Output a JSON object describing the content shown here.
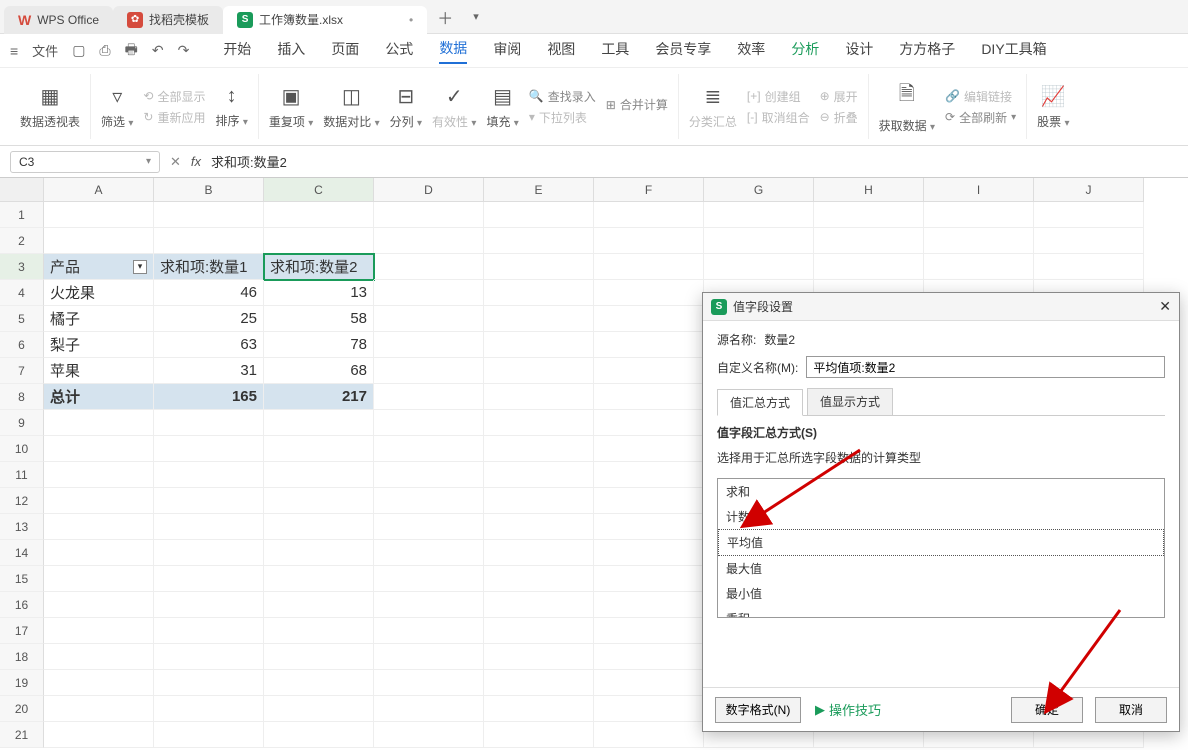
{
  "tabs": {
    "wps": "WPS Office",
    "dk": "找稻壳模板",
    "file": "工作簿数量.xlsx"
  },
  "menu": {
    "file": "文件",
    "items": [
      "开始",
      "插入",
      "页面",
      "公式",
      "数据",
      "审阅",
      "视图",
      "工具",
      "会员专享",
      "效率",
      "分析",
      "设计",
      "方方格子",
      "DIY工具箱"
    ],
    "active_index": 4
  },
  "ribbon": {
    "pivot": "数据透视表",
    "filter": "筛选",
    "showall": "全部显示",
    "reapply": "重新应用",
    "sort": "排序",
    "dup": "重复项",
    "datacompare": "数据对比",
    "split": "分列",
    "validity": "有效性",
    "fill": "填充",
    "findrec": "查找录入",
    "merge": "合并计算",
    "dropdown": "下拉列表",
    "subtotal": "分类汇总",
    "group": "创建组",
    "ungroup": "取消组合",
    "expand": "展开",
    "collapse": "折叠",
    "getdata": "获取数据",
    "editlink": "编辑链接",
    "refreshall": "全部刷新",
    "stock": "股票"
  },
  "formula": {
    "namebox": "C3",
    "value": "求和项:数量2"
  },
  "columns": [
    "A",
    "B",
    "C",
    "D",
    "E",
    "F",
    "G",
    "H",
    "I",
    "J"
  ],
  "rows": 21,
  "pivot": {
    "headers": [
      "产品",
      "求和项:数量1",
      "求和项:数量2"
    ],
    "data": [
      {
        "p": "火龙果",
        "q1": 46,
        "q2": 13
      },
      {
        "p": "橘子",
        "q1": 25,
        "q2": 58
      },
      {
        "p": "梨子",
        "q1": 63,
        "q2": 78
      },
      {
        "p": "苹果",
        "q1": 31,
        "q2": 68
      }
    ],
    "total_label": "总计",
    "total_q1": 165,
    "total_q2": 217
  },
  "dialog": {
    "title": "值字段设置",
    "source_label": "源名称:",
    "source_value": "数量2",
    "custom_label": "自定义名称(M):",
    "custom_value": "平均值项:数量2",
    "tab1": "值汇总方式",
    "tab2": "值显示方式",
    "section": "值字段汇总方式(S)",
    "hint": "选择用于汇总所选字段数据的计算类型",
    "funcs": [
      "求和",
      "计数",
      "平均值",
      "最大值",
      "最小值",
      "乘积"
    ],
    "selected_index": 2,
    "numfmt": "数字格式(N)",
    "tips": "操作技巧",
    "ok": "确定",
    "cancel": "取消"
  }
}
